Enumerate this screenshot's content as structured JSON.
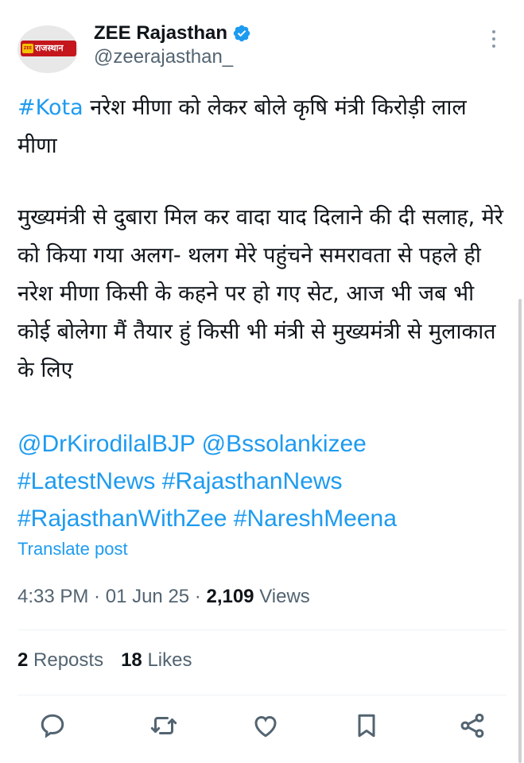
{
  "account": {
    "avatar_label": "राजस्थान",
    "avatar_mark": "ZEE",
    "display_name": "ZEE Rajasthan",
    "handle": "@zeerajasthan_",
    "verified_icon": "verified-badge-icon",
    "more_icon": "more-options-icon"
  },
  "post": {
    "line1_tag": "#Kota",
    "line1_text": " नरेश मीणा को लेकर बोले कृषि मंत्री किरोड़ी लाल मीणा",
    "paragraph2": "मुख्यमंत्री से दुबारा मिल कर वादा याद दिलाने की दी सलाह, मेरे को किया गया अलग- थलग मेरे पहुंचने समरावता से पहले ही नरेश मीणा किसी के कहने पर हो गए सेट, आज भी जब भी कोई बोलेगा मैं तैयार हुं किसी भी मंत्री से मुख्यमंत्री से मुलाकात के लिए",
    "tags_line1": "@DrKirodilalBJP @Bssolankizee",
    "tags_line2": "#LatestNews #RajasthanNews",
    "tags_line3": "#RajasthanWithZee #NareshMeena",
    "translate_label": "Translate post"
  },
  "meta": {
    "time": "4:33 PM",
    "sep1": " · ",
    "date": "01 Jun 25",
    "sep2": " · ",
    "views_count": "2,109",
    "views_label": " Views"
  },
  "stats": {
    "reposts_count": "2",
    "reposts_label": " Reposts",
    "likes_count": "18",
    "likes_label": " Likes"
  },
  "actions": {
    "reply_icon": "reply-icon",
    "repost_icon": "repost-icon",
    "like_icon": "heart-icon",
    "bookmark_icon": "bookmark-icon",
    "share_icon": "share-icon"
  },
  "colors": {
    "link": "#1d9bf0",
    "secondary_text": "#536471",
    "primary_text": "#0f1419",
    "verified": "#1d9bf0"
  }
}
